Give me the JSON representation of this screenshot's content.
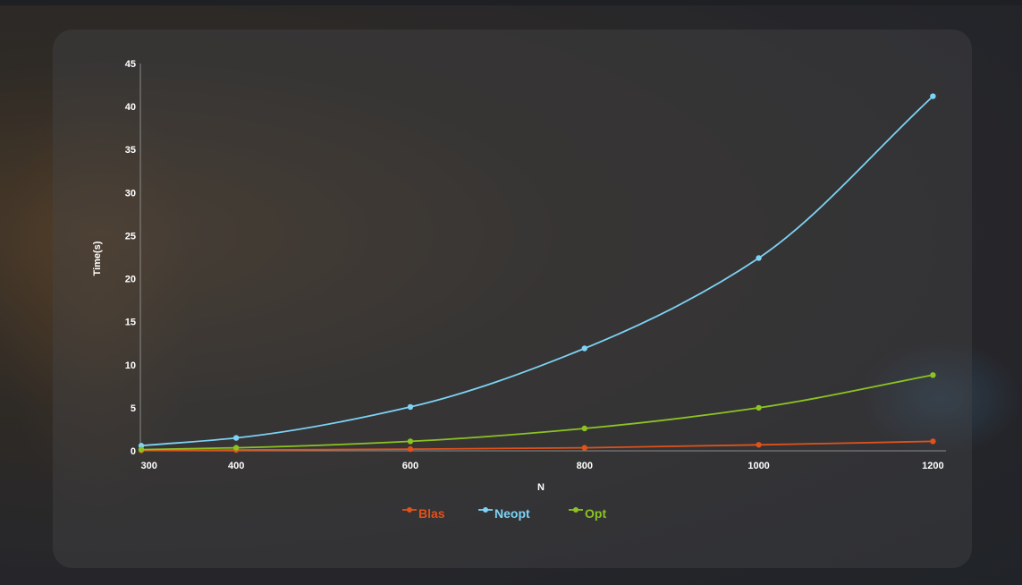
{
  "chart_data": {
    "type": "line",
    "title": "",
    "xlabel": "N",
    "ylabel": "Time(s)",
    "x": [
      300,
      400,
      600,
      800,
      1000,
      1200
    ],
    "xlim": [
      290,
      1215
    ],
    "ylim": [
      0,
      45
    ],
    "x_ticks": [
      "300",
      "400",
      "600",
      "800",
      "1000",
      "1200"
    ],
    "y_ticks": [
      "0",
      "5",
      "10",
      "15",
      "20",
      "25",
      "30",
      "35",
      "40",
      "45"
    ],
    "grid": false,
    "smooth": true,
    "legend_position": "bottom-center",
    "series": [
      {
        "name": "Blas",
        "color": "#e0521a",
        "values": [
          0.05,
          0.1,
          0.2,
          0.35,
          0.7,
          1.1
        ]
      },
      {
        "name": "Neopt",
        "color": "#7dd3f5",
        "values": [
          0.6,
          1.5,
          5.1,
          11.9,
          22.4,
          41.2
        ]
      },
      {
        "name": "Opt",
        "color": "#8cc322",
        "values": [
          0.15,
          0.35,
          1.1,
          2.6,
          5.0,
          8.8
        ]
      }
    ]
  }
}
